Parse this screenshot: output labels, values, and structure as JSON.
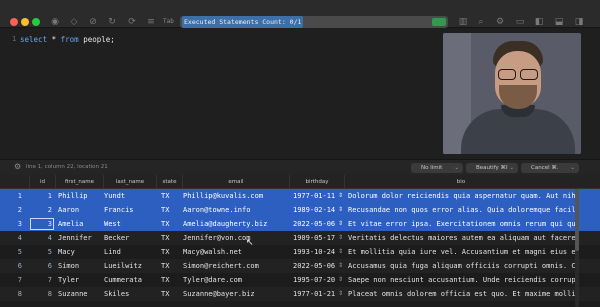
{
  "titlebar": {
    "db_label": "Tab",
    "status_text": "Executed Statements Count: 0/1"
  },
  "editor": {
    "line_number": "1",
    "sql_keyword_select": "select",
    "sql_rest_1": " * ",
    "sql_keyword_from": "from",
    "sql_rest_2": " people;"
  },
  "statusbar": {
    "cursor_info": "line 1, column 22, location 21",
    "limit_label": "No limit",
    "beautify_label": "Beautify ⌘I",
    "cancel_label": "Cancel ⌘."
  },
  "table": {
    "columns": [
      "id",
      "first_name",
      "last_name",
      "state",
      "email",
      "birthday",
      "bio"
    ],
    "rows": [
      {
        "id": "1",
        "first_name": "Phillip",
        "last_name": "Yundt",
        "state": "TX",
        "email": "Phillip@kuvalis.com",
        "birthday": "1977-01-11",
        "bio": "Dolorum dolor reiciendis quia aspernatur quam. Aut nihi"
      },
      {
        "id": "2",
        "first_name": "Aaron",
        "last_name": "Francis",
        "state": "TX",
        "email": "Aaron@towne.info",
        "birthday": "1989-02-14",
        "bio": "Recusandae non quos error alias. Quia doloremque facil"
      },
      {
        "id": "3",
        "first_name": "Amelia",
        "last_name": "West",
        "state": "TX",
        "email": "Amelia@daugherty.biz",
        "birthday": "2022-05-06",
        "bio": "Et vitae error ipsa. Exercitationem omnis rerum qui qu"
      },
      {
        "id": "4",
        "first_name": "Jennifer",
        "last_name": "Becker",
        "state": "TX",
        "email": "Jennifer@von.com",
        "birthday": "1909-05-17",
        "bio": "Veritatis delectus maiores autem ea aliquam aut facere"
      },
      {
        "id": "5",
        "first_name": "Macy",
        "last_name": "Lind",
        "state": "TX",
        "email": "Macy@walsh.net",
        "birthday": "1993-10-24",
        "bio": "Et mollitia quia iure vel. Accusantium et magni eius e"
      },
      {
        "id": "6",
        "first_name": "Simon",
        "last_name": "Lueilwitz",
        "state": "TX",
        "email": "Simon@reichert.com",
        "birthday": "2022-05-06",
        "bio": "Accusamus quia fuga aliquam officiis corrupti omnis. C"
      },
      {
        "id": "7",
        "first_name": "Tyler",
        "last_name": "Cummerata",
        "state": "TX",
        "email": "Tyler@dare.com",
        "birthday": "1995-07-20",
        "bio": "Saepe non nesciunt accusantium. Unde reiciendis corrup"
      },
      {
        "id": "8",
        "first_name": "Suzanne",
        "last_name": "Skiles",
        "state": "TX",
        "email": "Suzanne@bayer.biz",
        "birthday": "1977-01-21",
        "bio": "Placeat omnis dolorem officia est quo. Et maxime molli"
      }
    ]
  },
  "colors": {
    "selection": "#2c5fbf",
    "keyword": "#67a8f4",
    "status_pill": "#3d6fa8"
  }
}
